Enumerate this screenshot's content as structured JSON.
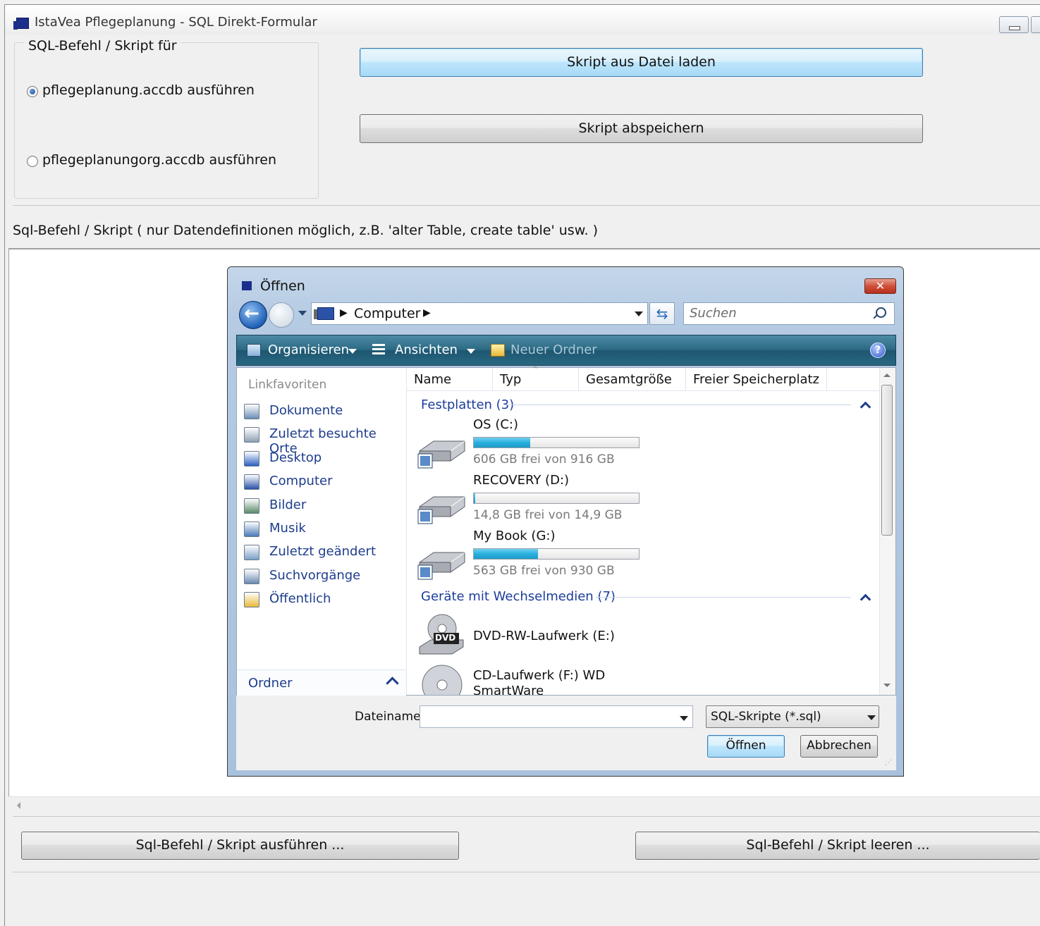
{
  "window": {
    "title": "IstaVea Pflegeplanung - SQL Direkt-Formular"
  },
  "group": {
    "legend": "SQL-Befehl / Skript für",
    "options": [
      {
        "label": "pflegeplanung.accdb ausführen",
        "selected": true
      },
      {
        "label": "pflegeplanungorg.accdb ausführen",
        "selected": false
      }
    ]
  },
  "buttons": {
    "load": "Skript aus Datei laden",
    "save": "Skript abspeichern",
    "execute": "Sql-Befehl / Skript ausführen ...",
    "clear": "Sql-Befehl / Skript leeren ..."
  },
  "sql_label": "Sql-Befehl / Skript ( nur Datendefinitionen möglich, z.B. 'alter Table, create table' usw. )",
  "dialog": {
    "title": "Öffnen",
    "close_label": "✕",
    "address": {
      "location": "Computer",
      "sep": "▶"
    },
    "search_placeholder": "Suchen",
    "toolbar": {
      "organize": "Organisieren",
      "views": "Ansichten",
      "new_folder": "Neuer Ordner",
      "help": "?"
    },
    "nav": {
      "title": "Linkfavoriten",
      "items": [
        {
          "label": "Dokumente",
          "icon": "documents-icon",
          "color": "#6b8fb5"
        },
        {
          "label": "Zuletzt besuchte Orte",
          "icon": "recent-places-icon",
          "color": "#8ea0b4"
        },
        {
          "label": "Desktop",
          "icon": "desktop-icon",
          "color": "#2a60c0"
        },
        {
          "label": "Computer",
          "icon": "computer-icon",
          "color": "#2a52a8"
        },
        {
          "label": "Bilder",
          "icon": "pictures-icon",
          "color": "#5a8a6a"
        },
        {
          "label": "Musik",
          "icon": "music-icon",
          "color": "#4a7ab8"
        },
        {
          "label": "Zuletzt geändert",
          "icon": "recently-changed-icon",
          "color": "#7aa0c8"
        },
        {
          "label": "Suchvorgänge",
          "icon": "searches-icon",
          "color": "#6a8ab0"
        },
        {
          "label": "Öffentlich",
          "icon": "public-folder-icon",
          "color": "#e8b838"
        }
      ],
      "folders_label": "Ordner"
    },
    "columns": [
      "Name",
      "Typ",
      "Gesamtgröße",
      "Freier Speicherplatz"
    ],
    "groups": {
      "hard_drives": "Festplatten (3)",
      "removable": "Geräte mit Wechselmedien (7)"
    },
    "drives": [
      {
        "name": "OS (C:)",
        "free_text": "606 GB frei von 916 GB",
        "used_fraction": 0.34
      },
      {
        "name": "RECOVERY (D:)",
        "free_text": "14,8 GB frei von 14,9 GB",
        "used_fraction": 0.01
      },
      {
        "name": "My Book (G:)",
        "free_text": "563 GB frei von 930 GB",
        "used_fraction": 0.39
      }
    ],
    "removable_devices": [
      {
        "name": "DVD-RW-Laufwerk (E:)",
        "badge": "DVD"
      },
      {
        "name": "CD-Laufwerk (F:) WD SmartWare"
      }
    ],
    "filename_label": "Dateiname:",
    "filename_value": "",
    "filetype": "SQL-Skripte (*.sql)",
    "open": "Öffnen",
    "cancel": "Abbrechen"
  }
}
